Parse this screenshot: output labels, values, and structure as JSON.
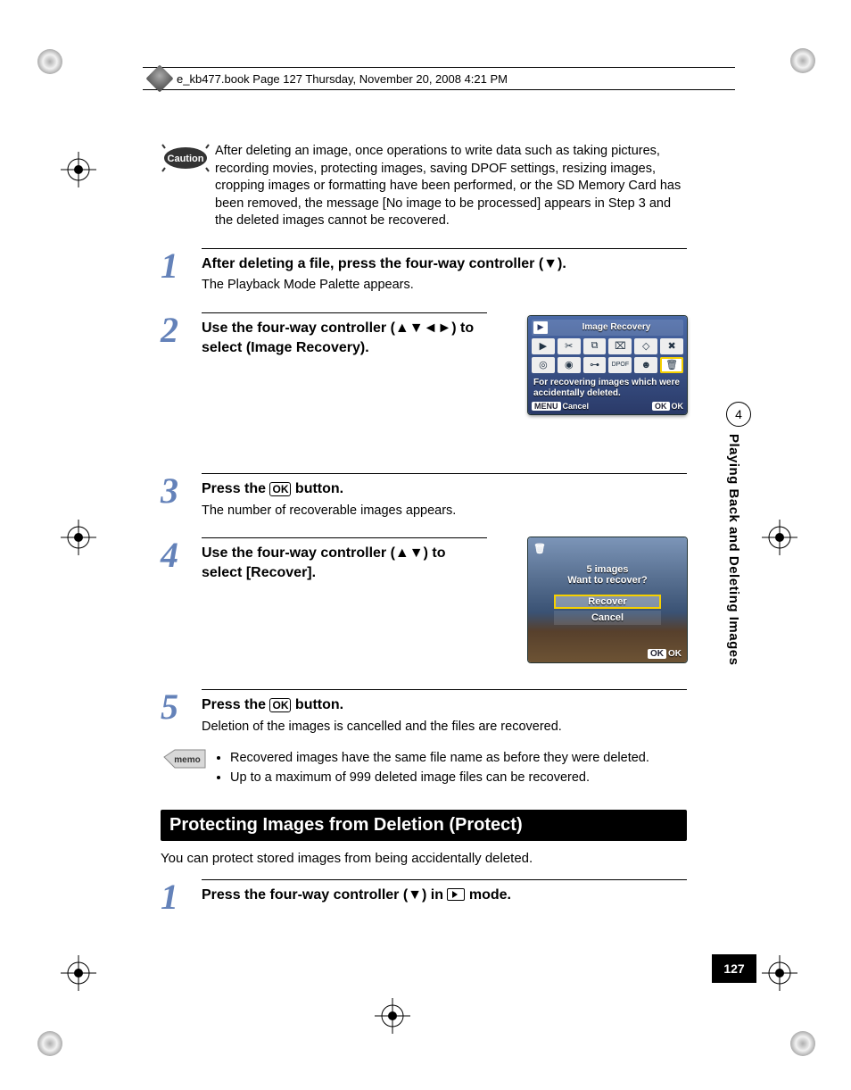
{
  "header": {
    "running_head": "e_kb477.book  Page 127  Thursday, November 20, 2008  4:21 PM"
  },
  "caution": {
    "label": "Caution",
    "text": "After deleting an image, once operations to write data such as taking pictures, recording movies, protecting images, saving DPOF settings, resizing images, cropping images or formatting have been performed, or the SD Memory Card has been removed, the message [No image to be processed] appears in Step 3 and the deleted images cannot be recovered."
  },
  "steps": {
    "s1": {
      "num": "1",
      "head": "After deleting a file, press the four-way controller (▼).",
      "text": "The Playback Mode Palette appears."
    },
    "s2": {
      "num": "2",
      "head": "Use the four-way controller (▲▼◄►) to select   (Image Recovery)."
    },
    "s3": {
      "num": "3",
      "head": "Press the OK button.",
      "text": "The number of recoverable images appears."
    },
    "s4": {
      "num": "4",
      "head": "Use the four-way controller (▲▼) to select [Recover]."
    },
    "s5": {
      "num": "5",
      "head": "Press the OK button.",
      "text": "Deletion of the images is cancelled and the files are recovered."
    }
  },
  "screen1": {
    "title": "Image Recovery",
    "desc": "For recovering images which were accidentally deleted.",
    "menu_label": "MENU",
    "cancel": "Cancel",
    "ok_label": "OK",
    "ok": "OK"
  },
  "screen2": {
    "count": "5 images",
    "prompt": "Want to recover?",
    "opt1": "Recover",
    "opt2": "Cancel",
    "ok_label": "OK",
    "ok": "OK"
  },
  "memo": {
    "label": "memo",
    "b1": "Recovered images have the same file name as before they were deleted.",
    "b2": "Up to a maximum of 999 deleted image files can be recovered."
  },
  "section": {
    "title": "Protecting Images from Deletion (Protect)",
    "intro": "You can protect stored images from being accidentally deleted."
  },
  "protect_step1": {
    "num": "1",
    "head_pre": "Press the four-way controller (▼) in ",
    "head_post": " mode."
  },
  "sidebar": {
    "chapter": "4",
    "title": "Playing Back and Deleting Images"
  },
  "page_number": "127"
}
